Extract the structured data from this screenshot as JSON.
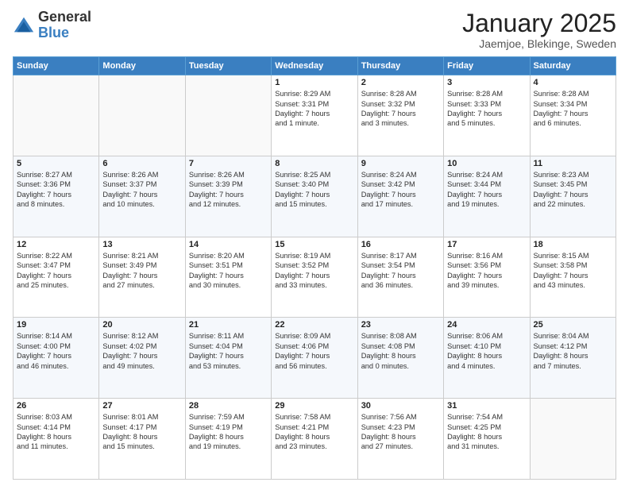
{
  "logo": {
    "general": "General",
    "blue": "Blue"
  },
  "header": {
    "month": "January 2025",
    "location": "Jaemjoe, Blekinge, Sweden"
  },
  "weekdays": [
    "Sunday",
    "Monday",
    "Tuesday",
    "Wednesday",
    "Thursday",
    "Friday",
    "Saturday"
  ],
  "weeks": [
    [
      {
        "day": "",
        "detail": ""
      },
      {
        "day": "",
        "detail": ""
      },
      {
        "day": "",
        "detail": ""
      },
      {
        "day": "1",
        "detail": "Sunrise: 8:29 AM\nSunset: 3:31 PM\nDaylight: 7 hours\nand 1 minute."
      },
      {
        "day": "2",
        "detail": "Sunrise: 8:28 AM\nSunset: 3:32 PM\nDaylight: 7 hours\nand 3 minutes."
      },
      {
        "day": "3",
        "detail": "Sunrise: 8:28 AM\nSunset: 3:33 PM\nDaylight: 7 hours\nand 5 minutes."
      },
      {
        "day": "4",
        "detail": "Sunrise: 8:28 AM\nSunset: 3:34 PM\nDaylight: 7 hours\nand 6 minutes."
      }
    ],
    [
      {
        "day": "5",
        "detail": "Sunrise: 8:27 AM\nSunset: 3:36 PM\nDaylight: 7 hours\nand 8 minutes."
      },
      {
        "day": "6",
        "detail": "Sunrise: 8:26 AM\nSunset: 3:37 PM\nDaylight: 7 hours\nand 10 minutes."
      },
      {
        "day": "7",
        "detail": "Sunrise: 8:26 AM\nSunset: 3:39 PM\nDaylight: 7 hours\nand 12 minutes."
      },
      {
        "day": "8",
        "detail": "Sunrise: 8:25 AM\nSunset: 3:40 PM\nDaylight: 7 hours\nand 15 minutes."
      },
      {
        "day": "9",
        "detail": "Sunrise: 8:24 AM\nSunset: 3:42 PM\nDaylight: 7 hours\nand 17 minutes."
      },
      {
        "day": "10",
        "detail": "Sunrise: 8:24 AM\nSunset: 3:44 PM\nDaylight: 7 hours\nand 19 minutes."
      },
      {
        "day": "11",
        "detail": "Sunrise: 8:23 AM\nSunset: 3:45 PM\nDaylight: 7 hours\nand 22 minutes."
      }
    ],
    [
      {
        "day": "12",
        "detail": "Sunrise: 8:22 AM\nSunset: 3:47 PM\nDaylight: 7 hours\nand 25 minutes."
      },
      {
        "day": "13",
        "detail": "Sunrise: 8:21 AM\nSunset: 3:49 PM\nDaylight: 7 hours\nand 27 minutes."
      },
      {
        "day": "14",
        "detail": "Sunrise: 8:20 AM\nSunset: 3:51 PM\nDaylight: 7 hours\nand 30 minutes."
      },
      {
        "day": "15",
        "detail": "Sunrise: 8:19 AM\nSunset: 3:52 PM\nDaylight: 7 hours\nand 33 minutes."
      },
      {
        "day": "16",
        "detail": "Sunrise: 8:17 AM\nSunset: 3:54 PM\nDaylight: 7 hours\nand 36 minutes."
      },
      {
        "day": "17",
        "detail": "Sunrise: 8:16 AM\nSunset: 3:56 PM\nDaylight: 7 hours\nand 39 minutes."
      },
      {
        "day": "18",
        "detail": "Sunrise: 8:15 AM\nSunset: 3:58 PM\nDaylight: 7 hours\nand 43 minutes."
      }
    ],
    [
      {
        "day": "19",
        "detail": "Sunrise: 8:14 AM\nSunset: 4:00 PM\nDaylight: 7 hours\nand 46 minutes."
      },
      {
        "day": "20",
        "detail": "Sunrise: 8:12 AM\nSunset: 4:02 PM\nDaylight: 7 hours\nand 49 minutes."
      },
      {
        "day": "21",
        "detail": "Sunrise: 8:11 AM\nSunset: 4:04 PM\nDaylight: 7 hours\nand 53 minutes."
      },
      {
        "day": "22",
        "detail": "Sunrise: 8:09 AM\nSunset: 4:06 PM\nDaylight: 7 hours\nand 56 minutes."
      },
      {
        "day": "23",
        "detail": "Sunrise: 8:08 AM\nSunset: 4:08 PM\nDaylight: 8 hours\nand 0 minutes."
      },
      {
        "day": "24",
        "detail": "Sunrise: 8:06 AM\nSunset: 4:10 PM\nDaylight: 8 hours\nand 4 minutes."
      },
      {
        "day": "25",
        "detail": "Sunrise: 8:04 AM\nSunset: 4:12 PM\nDaylight: 8 hours\nand 7 minutes."
      }
    ],
    [
      {
        "day": "26",
        "detail": "Sunrise: 8:03 AM\nSunset: 4:14 PM\nDaylight: 8 hours\nand 11 minutes."
      },
      {
        "day": "27",
        "detail": "Sunrise: 8:01 AM\nSunset: 4:17 PM\nDaylight: 8 hours\nand 15 minutes."
      },
      {
        "day": "28",
        "detail": "Sunrise: 7:59 AM\nSunset: 4:19 PM\nDaylight: 8 hours\nand 19 minutes."
      },
      {
        "day": "29",
        "detail": "Sunrise: 7:58 AM\nSunset: 4:21 PM\nDaylight: 8 hours\nand 23 minutes."
      },
      {
        "day": "30",
        "detail": "Sunrise: 7:56 AM\nSunset: 4:23 PM\nDaylight: 8 hours\nand 27 minutes."
      },
      {
        "day": "31",
        "detail": "Sunrise: 7:54 AM\nSunset: 4:25 PM\nDaylight: 8 hours\nand 31 minutes."
      },
      {
        "day": "",
        "detail": ""
      }
    ]
  ]
}
